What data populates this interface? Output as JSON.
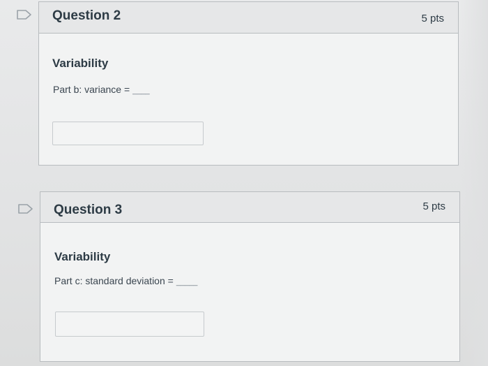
{
  "questions": [
    {
      "title": "Question 2",
      "points": "5 pts",
      "heading": "Variability",
      "prompt": "Part b: variance =",
      "blank": "____",
      "answer_value": "",
      "flag_icon": "bookmark-flag-icon"
    },
    {
      "title": "Question 3",
      "points": "5 pts",
      "heading": "Variability",
      "prompt": "Part c: standard deviation =",
      "blank": "_____",
      "answer_value": "",
      "flag_icon": "bookmark-flag-icon"
    }
  ],
  "colors": {
    "text": "#2d3b45",
    "card_border": "#b8bcbf",
    "header_bg": "#e6e7e8",
    "card_bg": "#f2f3f3"
  }
}
